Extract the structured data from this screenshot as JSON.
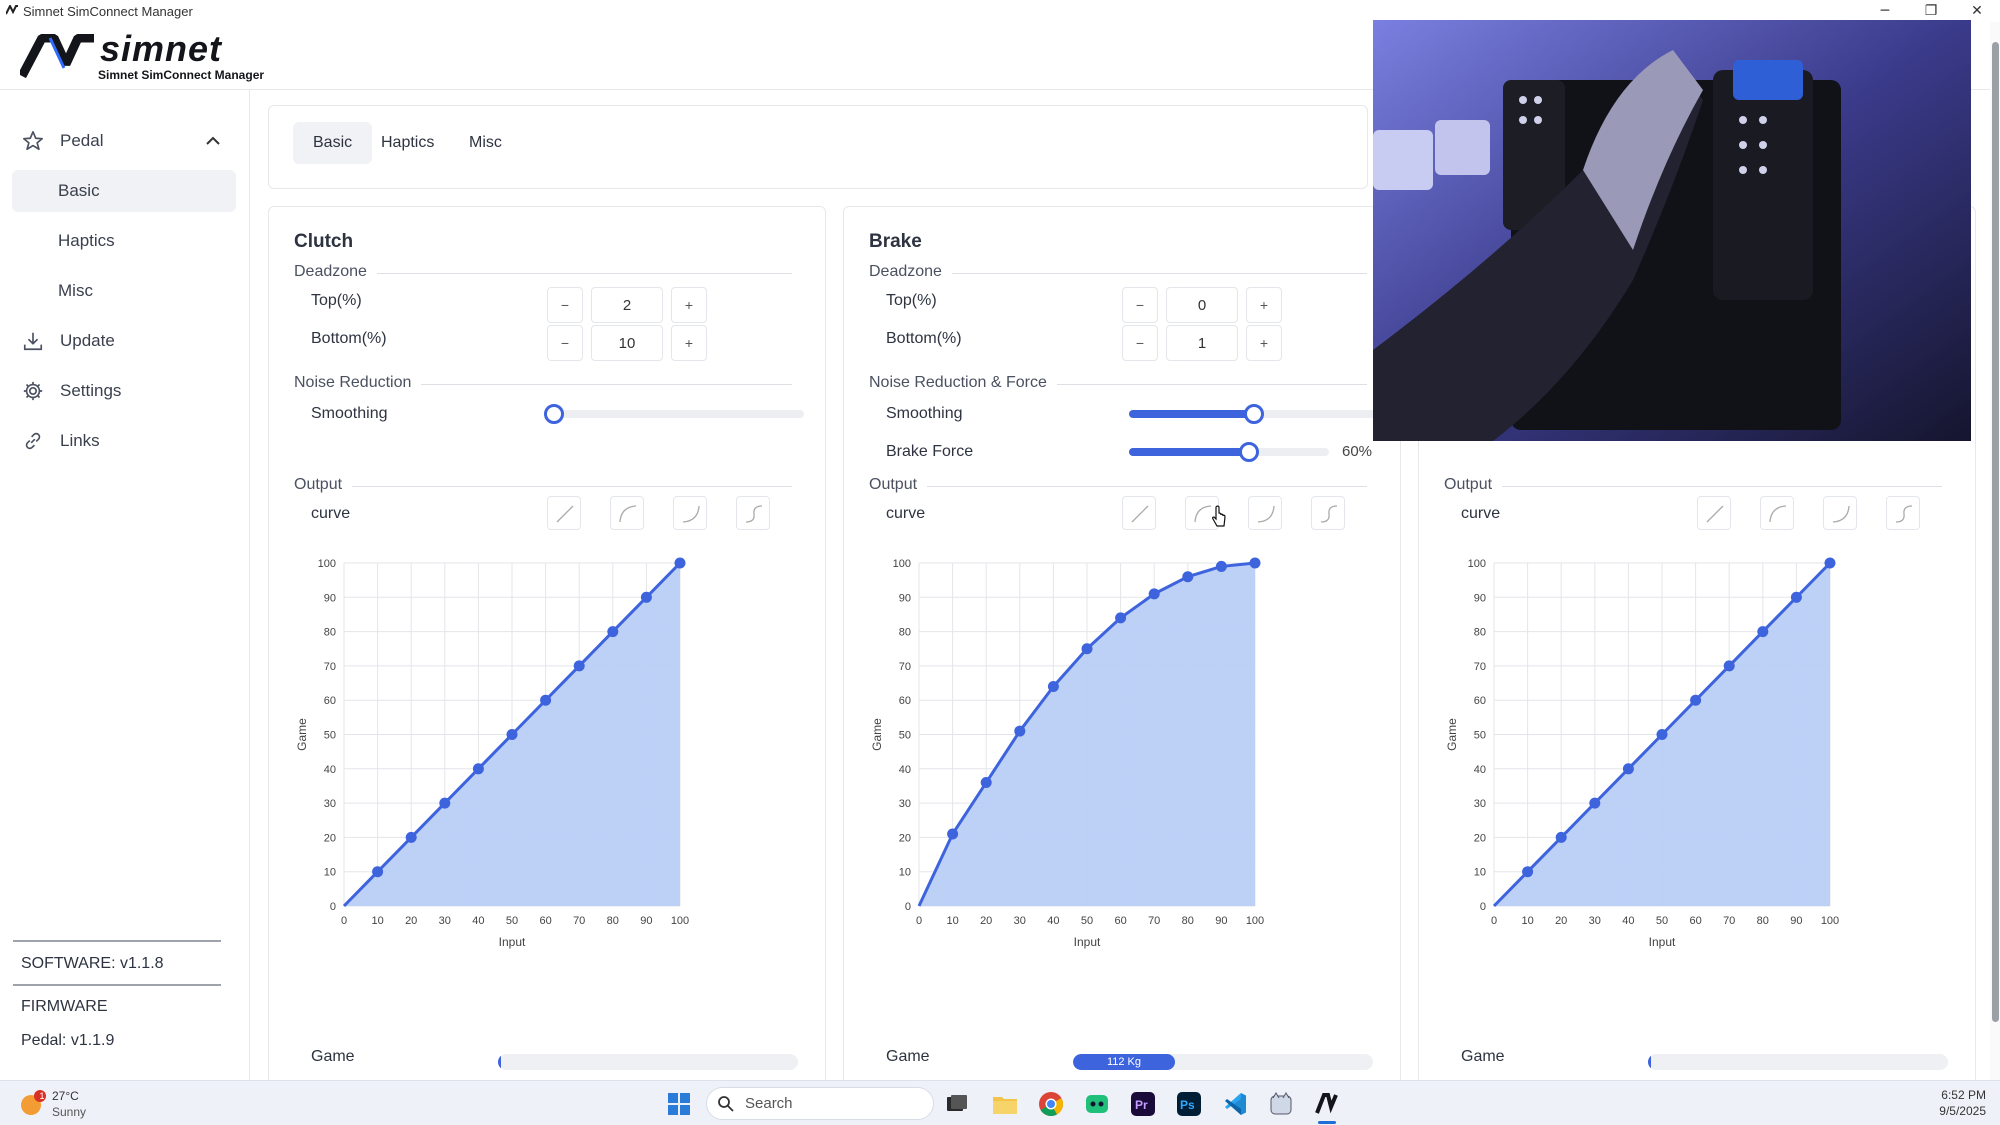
{
  "window": {
    "title": "Simnet SimConnect Manager",
    "minimize": "─",
    "maximize": "❐",
    "close": "✕"
  },
  "header": {
    "logo_word": "simnet",
    "logo_sub": "Simnet SimConnect Manager"
  },
  "sidebar": {
    "group": "Pedal",
    "subitems": [
      "Basic",
      "Haptics",
      "Misc"
    ],
    "active_subitem": "Basic",
    "items": [
      {
        "label": "Update",
        "icon": "download-icon"
      },
      {
        "label": "Settings",
        "icon": "gear-icon"
      },
      {
        "label": "Links",
        "icon": "link-icon"
      }
    ],
    "software": "SOFTWARE: v1.1.8",
    "firmware_heading": "FIRMWARE",
    "firmware": "Pedal: v1.1.9"
  },
  "tabs": [
    "Basic",
    "Haptics",
    "Misc"
  ],
  "active_tab": "Basic",
  "panels": [
    {
      "title": "Clutch",
      "deadzone_label": "Deadzone",
      "top_label": "Top(%)",
      "top_value": "2",
      "bottom_label": "Bottom(%)",
      "bottom_value": "10",
      "noise_label": "Noise Reduction",
      "smoothing_label": "Smoothing",
      "smoothing_level": 0,
      "output_label": "Output",
      "curve_label": "curve",
      "game_label": "Game",
      "game_fill": 0.01,
      "game_text": ""
    },
    {
      "title": "Brake",
      "deadzone_label": "Deadzone",
      "top_label": "Top(%)",
      "top_value": "0",
      "bottom_label": "Bottom(%)",
      "bottom_value": "1",
      "noise_label": "Noise Reduction & Force",
      "smoothing_label": "Smoothing",
      "smoothing_level": 0.5,
      "force_label": "Brake Force",
      "force_level": 0.6,
      "force_text": "60%",
      "output_label": "Output",
      "curve_label": "curve",
      "game_label": "Game",
      "game_fill": 0.34,
      "game_text": "112 Kg"
    },
    {
      "output_label": "Output",
      "curve_label": "curve",
      "game_label": "Game",
      "game_fill": 0.01,
      "game_text": ""
    }
  ],
  "chart_data": [
    {
      "type": "area",
      "xlabel": "Input",
      "ylabel": "Game",
      "xlim": [
        0,
        100
      ],
      "ylim": [
        0,
        100
      ],
      "x": [
        0,
        10,
        20,
        30,
        40,
        50,
        60,
        70,
        80,
        90,
        100
      ],
      "y": [
        0,
        10,
        20,
        30,
        40,
        50,
        60,
        70,
        80,
        90,
        100
      ],
      "xticks": [
        0,
        10,
        20,
        30,
        40,
        50,
        60,
        70,
        80,
        90,
        100
      ],
      "yticks": [
        0,
        10,
        20,
        30,
        40,
        50,
        60,
        70,
        80,
        90,
        100
      ],
      "grid": true
    },
    {
      "type": "area",
      "xlabel": "Input",
      "ylabel": "Game",
      "xlim": [
        0,
        100
      ],
      "ylim": [
        0,
        100
      ],
      "x": [
        0,
        10,
        20,
        30,
        40,
        50,
        60,
        70,
        80,
        90,
        100
      ],
      "y": [
        0,
        21,
        36,
        51,
        64,
        75,
        84,
        91,
        96,
        99,
        100
      ],
      "xticks": [
        0,
        10,
        20,
        30,
        40,
        50,
        60,
        70,
        80,
        90,
        100
      ],
      "yticks": [
        0,
        10,
        20,
        30,
        40,
        50,
        60,
        70,
        80,
        90,
        100
      ],
      "grid": true
    },
    {
      "type": "area",
      "xlabel": "Input",
      "ylabel": "Game",
      "xlim": [
        0,
        100
      ],
      "ylim": [
        0,
        100
      ],
      "x": [
        0,
        10,
        20,
        30,
        40,
        50,
        60,
        70,
        80,
        90,
        100
      ],
      "y": [
        0,
        10,
        20,
        30,
        40,
        50,
        60,
        70,
        80,
        90,
        100
      ],
      "xticks": [
        0,
        10,
        20,
        30,
        40,
        50,
        60,
        70,
        80,
        90,
        100
      ],
      "yticks": [
        0,
        10,
        20,
        30,
        40,
        50,
        60,
        70,
        80,
        90,
        100
      ],
      "grid": true
    }
  ],
  "colors": {
    "accent": "#3d63dd",
    "area_fill": "#b9cdf6",
    "video_bg": "#27264a"
  },
  "taskbar": {
    "weather_temp": "27°C",
    "weather_desc": "Sunny",
    "weather_badge": "1",
    "search_placeholder": "Search",
    "time": "6:52 PM",
    "date": "9/5/2025",
    "apps": [
      "windows-start-icon",
      "search-icon",
      "task-view-icon",
      "file-explorer-icon",
      "chrome-icon",
      "app-green-icon",
      "premiere-icon",
      "photoshop-icon",
      "vscode-icon",
      "app-kitty-icon",
      "simnet-icon"
    ]
  }
}
